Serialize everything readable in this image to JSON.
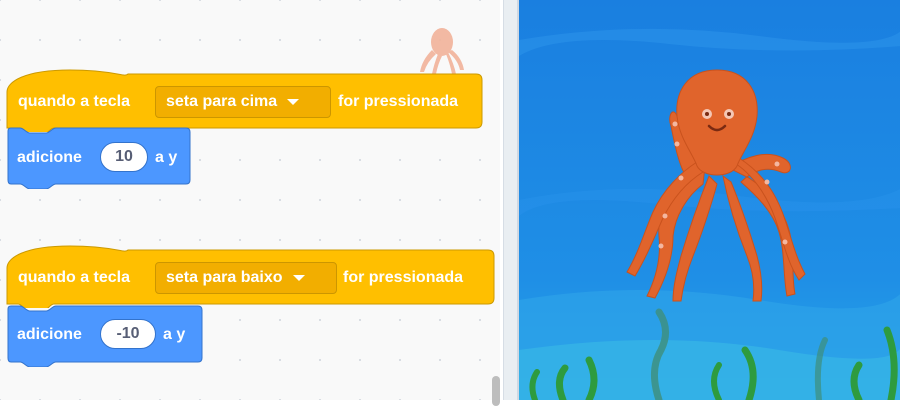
{
  "code_area": {
    "script_up": {
      "hat_prefix": "quando a tecla",
      "key_option": "seta para cima",
      "hat_suffix": "for pressionada",
      "motion_label": "adicione",
      "motion_value": "10",
      "motion_suffix": "a y"
    },
    "script_down": {
      "hat_prefix": "quando a tecla",
      "key_option": "seta para baixo",
      "hat_suffix": "for pressionada",
      "motion_label": "adicione",
      "motion_value": "-10",
      "motion_suffix": "a y"
    },
    "sprite_thumbnail_icon": "octopus-icon"
  },
  "stage": {
    "sprite_icon": "octopus-icon",
    "backdrop": "underwater"
  },
  "colors": {
    "events_block": "#ffbf00",
    "events_border": "#cc9900",
    "motion_block": "#4c97ff",
    "motion_border": "#3373cc",
    "octopus": "#e0642c",
    "water": "#1c8ce6"
  }
}
